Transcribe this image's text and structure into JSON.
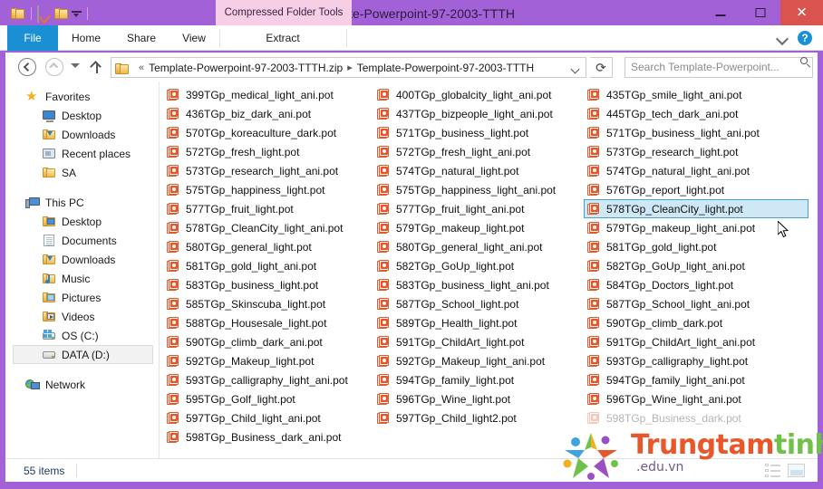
{
  "window": {
    "title": "Template-Powerpoint-97-2003-TTTH",
    "contextual_tab": "Compressed Folder Tools",
    "minimize_label": "Minimize",
    "maximize_label": "Maximize",
    "close_label": "✕",
    "accent_color": "#a361d8",
    "contextual_tab_color": "#f6cfe6"
  },
  "quick_access": {
    "items": [
      "folder-icon",
      "properties-icon",
      "new-folder-icon",
      "customize-dropdown-icon"
    ]
  },
  "ribbon": {
    "tabs": [
      {
        "label": "File",
        "active": true
      },
      {
        "label": "Home",
        "active": false
      },
      {
        "label": "Share",
        "active": false
      },
      {
        "label": "View",
        "active": false
      },
      {
        "label": "Extract",
        "active": false
      }
    ],
    "file_tab_color": "#1a8fd4",
    "collapse_icon": "chevron-down-icon",
    "help_icon": "?"
  },
  "address": {
    "back_label": "Back",
    "forward_label": "Forward",
    "recent_label": "Recent locations",
    "up_label": "Up one level",
    "crumb_prefix": "«",
    "crumbs": [
      "Template-Powerpoint-97-2003-TTTH.zip",
      "Template-Powerpoint-97-2003-TTTH"
    ],
    "separator": "▸",
    "dropdown_icon": "chevron-down-icon",
    "refresh_glyph": "⟳",
    "search_placeholder": "Search Template-Powerpoint...",
    "search_value": ""
  },
  "sidebar": {
    "items": [
      {
        "label": "Favorites",
        "icon": "star-icon",
        "level": 0,
        "selected": false
      },
      {
        "label": "Desktop",
        "icon": "monitor-icon",
        "level": 1,
        "selected": false
      },
      {
        "label": "Downloads",
        "icon": "downloads-icon",
        "level": 1,
        "selected": false
      },
      {
        "label": "Recent places",
        "icon": "recent-icon",
        "level": 1,
        "selected": false
      },
      {
        "label": "SA",
        "icon": "folder-icon",
        "level": 1,
        "selected": false
      },
      {
        "label": "__GAP__",
        "icon": "",
        "level": 0,
        "selected": false
      },
      {
        "label": "This PC",
        "icon": "computer-icon",
        "level": 0,
        "selected": false
      },
      {
        "label": "Desktop",
        "icon": "desktop-folder-icon",
        "level": 1,
        "selected": false
      },
      {
        "label": "Documents",
        "icon": "documents-icon",
        "level": 1,
        "selected": false
      },
      {
        "label": "Downloads",
        "icon": "downloads-icon",
        "level": 1,
        "selected": false
      },
      {
        "label": "Music",
        "icon": "music-icon",
        "level": 1,
        "selected": false
      },
      {
        "label": "Pictures",
        "icon": "pictures-icon",
        "level": 1,
        "selected": false
      },
      {
        "label": "Videos",
        "icon": "videos-icon",
        "level": 1,
        "selected": false
      },
      {
        "label": "OS (C:)",
        "icon": "os-drive-icon",
        "level": 1,
        "selected": false
      },
      {
        "label": "DATA (D:)",
        "icon": "drive-icon",
        "level": 1,
        "selected": true
      },
      {
        "label": "__GAP__",
        "icon": "",
        "level": 0,
        "selected": false
      },
      {
        "label": "Network",
        "icon": "network-icon",
        "level": 0,
        "selected": false
      }
    ]
  },
  "files": {
    "icon": "powerpoint-template-icon",
    "columns": [
      [
        {
          "name": "399TGp_medical_light_ani.pot",
          "selected": false,
          "faded": false
        },
        {
          "name": "436TGp_biz_dark_ani.pot",
          "selected": false,
          "faded": false
        },
        {
          "name": "570TGp_koreaculture_dark.pot",
          "selected": false,
          "faded": false
        },
        {
          "name": "572TGp_fresh_light.pot",
          "selected": false,
          "faded": false
        },
        {
          "name": "573TGp_research_light_ani.pot",
          "selected": false,
          "faded": false
        },
        {
          "name": "575TGp_happiness_light.pot",
          "selected": false,
          "faded": false
        },
        {
          "name": "577TGp_fruit_light.pot",
          "selected": false,
          "faded": false
        },
        {
          "name": "578TGp_CleanCity_light_ani.pot",
          "selected": false,
          "faded": false
        },
        {
          "name": "580TGp_general_light.pot",
          "selected": false,
          "faded": false
        },
        {
          "name": "581TGp_gold_light_ani.pot",
          "selected": false,
          "faded": false
        },
        {
          "name": "583TGp_business_light.pot",
          "selected": false,
          "faded": false
        },
        {
          "name": "585TGp_Skinscuba_light.pot",
          "selected": false,
          "faded": false
        },
        {
          "name": "588TGp_Housesale_light.pot",
          "selected": false,
          "faded": false
        },
        {
          "name": "590TGp_climb_dark_ani.pot",
          "selected": false,
          "faded": false
        },
        {
          "name": "592TGp_Makeup_light.pot",
          "selected": false,
          "faded": false
        },
        {
          "name": "593TGp_calligraphy_light_ani.pot",
          "selected": false,
          "faded": false
        },
        {
          "name": "595TGp_Golf_light.pot",
          "selected": false,
          "faded": false
        },
        {
          "name": "597TGp_Child_light_ani.pot",
          "selected": false,
          "faded": false
        },
        {
          "name": "598TGp_Business_dark_ani.pot",
          "selected": false,
          "faded": false
        }
      ],
      [
        {
          "name": "400TGp_globalcity_light_ani.pot",
          "selected": false,
          "faded": false
        },
        {
          "name": "437TGp_bizpeople_light_ani.pot",
          "selected": false,
          "faded": false
        },
        {
          "name": "571TGp_business_light.pot",
          "selected": false,
          "faded": false
        },
        {
          "name": "572TGp_fresh_light_ani.pot",
          "selected": false,
          "faded": false
        },
        {
          "name": "574TGp_natural_light.pot",
          "selected": false,
          "faded": false
        },
        {
          "name": "575TGp_happiness_light_ani.pot",
          "selected": false,
          "faded": false
        },
        {
          "name": "577TGp_fruit_light_ani.pot",
          "selected": false,
          "faded": false
        },
        {
          "name": "579TGp_makeup_light.pot",
          "selected": false,
          "faded": false
        },
        {
          "name": "580TGp_general_light_ani.pot",
          "selected": false,
          "faded": false
        },
        {
          "name": "582TGp_GoUp_light.pot",
          "selected": false,
          "faded": false
        },
        {
          "name": "583TGp_business_light_ani.pot",
          "selected": false,
          "faded": false
        },
        {
          "name": "587TGp_School_light.pot",
          "selected": false,
          "faded": false
        },
        {
          "name": "589TGp_Health_light.pot",
          "selected": false,
          "faded": false
        },
        {
          "name": "591TGp_ChildArt_light.pot",
          "selected": false,
          "faded": false
        },
        {
          "name": "592TGp_Makeup_light_ani.pot",
          "selected": false,
          "faded": false
        },
        {
          "name": "594TGp_family_light.pot",
          "selected": false,
          "faded": false
        },
        {
          "name": "596TGp_Wine_light.pot",
          "selected": false,
          "faded": false
        },
        {
          "name": "597TGp_Child_light2.pot",
          "selected": false,
          "faded": false
        }
      ],
      [
        {
          "name": "435TGp_smile_light_ani.pot",
          "selected": false,
          "faded": false
        },
        {
          "name": "445TGp_tech_dark_ani.pot",
          "selected": false,
          "faded": false
        },
        {
          "name": "571TGp_business_light_ani.pot",
          "selected": false,
          "faded": false
        },
        {
          "name": "573TGp_research_light.pot",
          "selected": false,
          "faded": false
        },
        {
          "name": "574TGp_natural_light_ani.pot",
          "selected": false,
          "faded": false
        },
        {
          "name": "576TGp_report_light.pot",
          "selected": false,
          "faded": false
        },
        {
          "name": "578TGp_CleanCity_light.pot",
          "selected": true,
          "faded": false
        },
        {
          "name": "579TGp_makeup_light_ani.pot",
          "selected": false,
          "faded": false
        },
        {
          "name": "581TGp_gold_light.pot",
          "selected": false,
          "faded": false
        },
        {
          "name": "582TGp_GoUp_light_ani.pot",
          "selected": false,
          "faded": false
        },
        {
          "name": "584TGp_Doctors_light.pot",
          "selected": false,
          "faded": false
        },
        {
          "name": "587TGp_School_light_ani.pot",
          "selected": false,
          "faded": false
        },
        {
          "name": "590TGp_climb_dark.pot",
          "selected": false,
          "faded": false
        },
        {
          "name": "591TGp_ChildArt_light_ani.pot",
          "selected": false,
          "faded": false
        },
        {
          "name": "593TGp_calligraphy_light.pot",
          "selected": false,
          "faded": false
        },
        {
          "name": "594TGp_family_light_ani.pot",
          "selected": false,
          "faded": false
        },
        {
          "name": "596TGp_Wine_light_ani.pot",
          "selected": false,
          "faded": false
        },
        {
          "name": "598TGp_Business_dark.pot",
          "selected": false,
          "faded": true
        }
      ]
    ]
  },
  "status": {
    "item_count": "55 items",
    "view_details_label": "Details view",
    "view_icons_label": "Large icons view"
  },
  "watermark": {
    "text_part1": "Trung",
    "text_part2": "tam",
    "text_part3": "tin",
    "text_part4": "hoc",
    "subtitle": ".edu.vn",
    "color1": "#e8572a",
    "color2": "#9a4fc4",
    "color3": "#3fa3dd",
    "color4": "#6fc14a"
  }
}
